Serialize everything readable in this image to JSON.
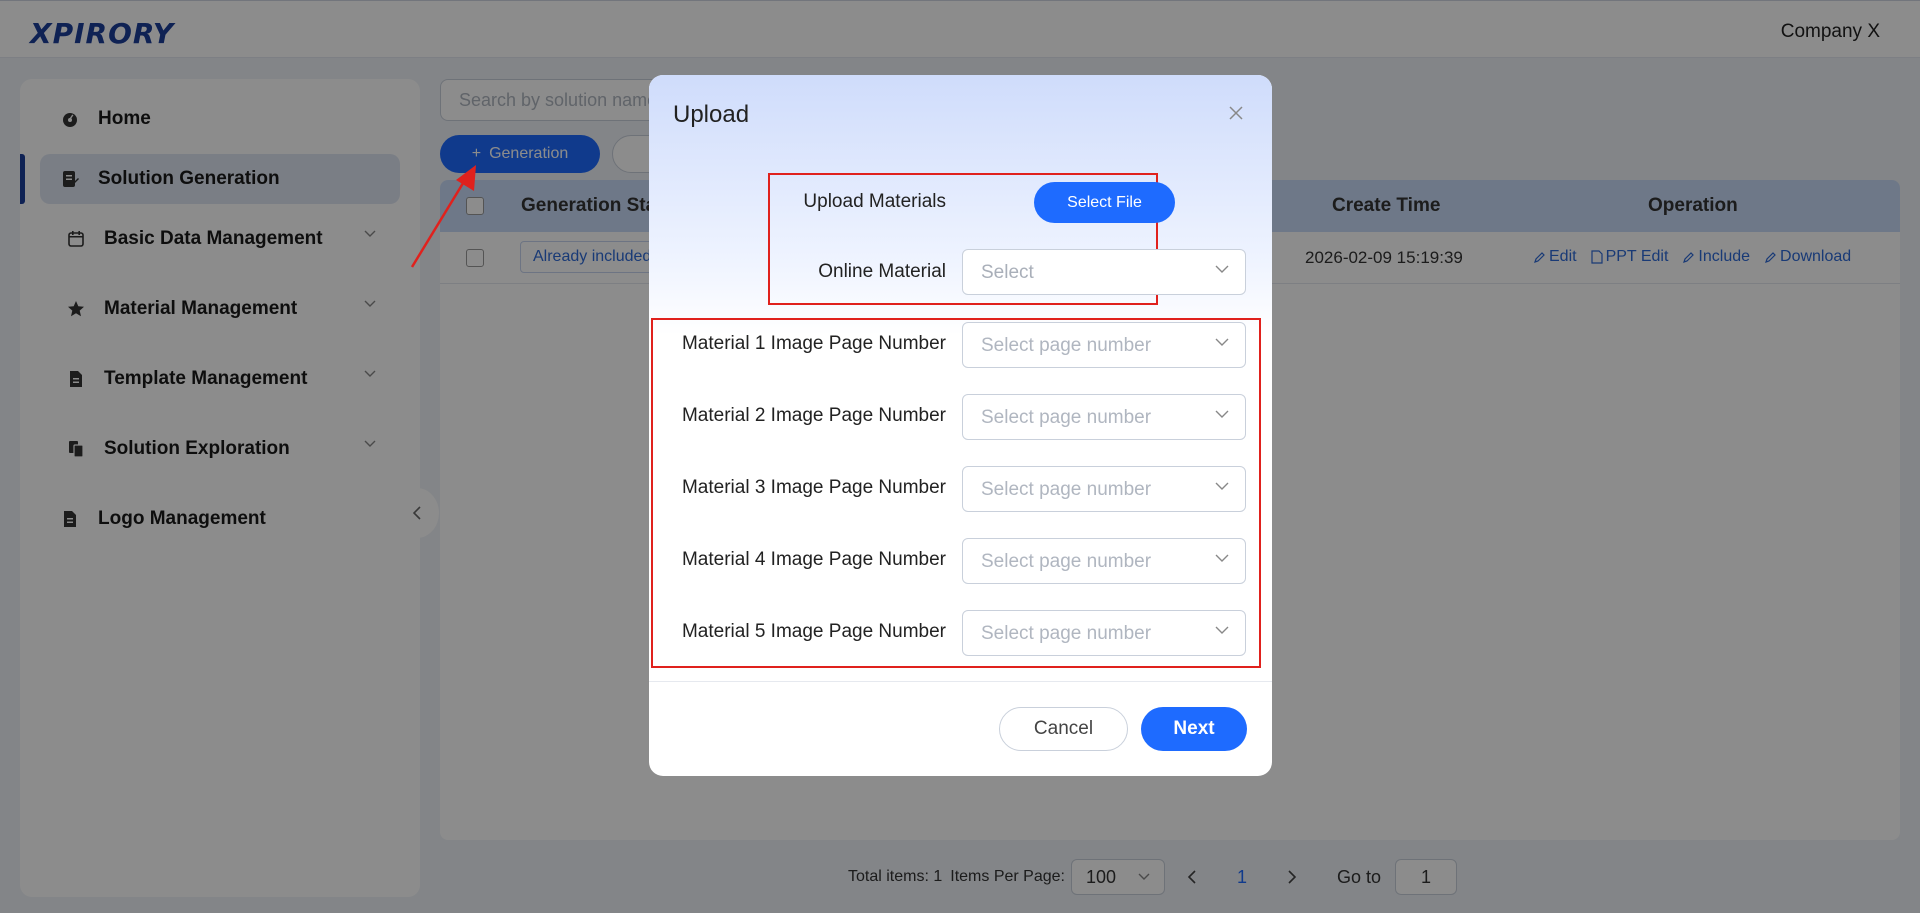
{
  "header": {
    "logo": "XPIRORY",
    "company": "Company X"
  },
  "sidebar": {
    "items": [
      {
        "label": "Home",
        "icon": "dashboard-icon"
      },
      {
        "label": "Solution Generation",
        "icon": "document-edit-icon",
        "active": true
      },
      {
        "label": "Basic Data Management",
        "icon": "calendar-icon"
      },
      {
        "label": "Material Management",
        "icon": "star-icon"
      },
      {
        "label": "Template Management",
        "icon": "file-icon"
      },
      {
        "label": "Solution Exploration",
        "icon": "copy-icon"
      },
      {
        "label": "Logo Management",
        "icon": "file-icon"
      }
    ]
  },
  "toolbar": {
    "search_placeholder": "Search by solution name",
    "generation_label": "Generation"
  },
  "table": {
    "columns": [
      "Generation Status",
      "Create Time",
      "Operation"
    ],
    "rows": [
      {
        "status": "Already included",
        "create_time": "2026-02-09 15:19:39",
        "ops": [
          "Edit",
          "PPT Edit",
          "Include",
          "Download"
        ]
      }
    ]
  },
  "pagination": {
    "total": "Total items: 1",
    "per_page_label": "Items Per Page:",
    "per_page": "100",
    "current": "1",
    "goto_label": "Go to",
    "goto_value": "1"
  },
  "modal": {
    "title": "Upload",
    "upload_label": "Upload Materials",
    "select_file": "Select File",
    "online_label": "Online Material",
    "online_placeholder": "Select",
    "page_fields": [
      {
        "label": "Material 1 Image Page Number",
        "placeholder": "Select page number"
      },
      {
        "label": "Material 2 Image Page Number",
        "placeholder": "Select page number"
      },
      {
        "label": "Material 3 Image Page Number",
        "placeholder": "Select page number"
      },
      {
        "label": "Material 4 Image Page Number",
        "placeholder": "Select page number"
      },
      {
        "label": "Material 5 Image Page Number",
        "placeholder": "Select page number"
      }
    ],
    "cancel": "Cancel",
    "next": "Next"
  },
  "colors": {
    "primary": "#1e6bff",
    "brand": "#1c3f9a",
    "annotation": "#e0211d"
  }
}
